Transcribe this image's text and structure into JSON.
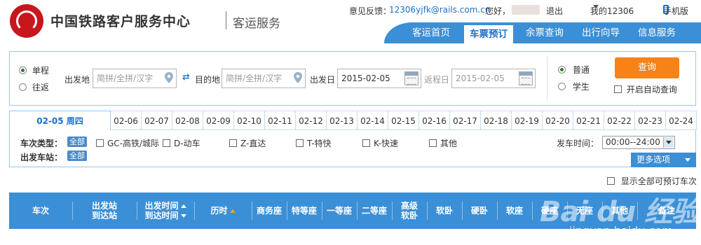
{
  "header": {
    "site_title": "中国铁路客户服务中心",
    "site_subtitle": "客运服务",
    "feedback_label": "意见反馈：",
    "feedback_email": "12306yjfk@rails.com.cn",
    "greeting": "您好，",
    "logout": "退出",
    "my_account": "我的12306",
    "mobile": "手机版"
  },
  "nav": {
    "items": [
      {
        "label": "客运首页"
      },
      {
        "label": "车票预订",
        "active": true
      },
      {
        "label": "余票查询"
      },
      {
        "label": "出行向导"
      },
      {
        "label": "信息服务"
      }
    ]
  },
  "search": {
    "trip_types": [
      {
        "label": "单程",
        "checked": true
      },
      {
        "label": "往返",
        "checked": false
      }
    ],
    "from_label": "出发地",
    "from_placeholder": "简拼/全拼/汉字",
    "to_label": "目的地",
    "to_placeholder": "简拼/全拼/汉字",
    "depart_label": "出发日",
    "depart_value": "2015-02-05",
    "return_label": "返程日",
    "return_value": "2015-02-05",
    "ticket_types": [
      {
        "label": "普通",
        "checked": true
      },
      {
        "label": "学生",
        "checked": false
      }
    ],
    "query_button": "查询",
    "auto_query_label": "开启自动查询"
  },
  "date_tabs": [
    {
      "label": "02-05 周四",
      "active": true
    },
    {
      "label": "02-06"
    },
    {
      "label": "02-07"
    },
    {
      "label": "02-08"
    },
    {
      "label": "02-09"
    },
    {
      "label": "02-10"
    },
    {
      "label": "02-11"
    },
    {
      "label": "02-12"
    },
    {
      "label": "02-13"
    },
    {
      "label": "02-14"
    },
    {
      "label": "02-15"
    },
    {
      "label": "02-16"
    },
    {
      "label": "02-17"
    },
    {
      "label": "02-18"
    },
    {
      "label": "02-19"
    },
    {
      "label": "02-20"
    },
    {
      "label": "02-21"
    },
    {
      "label": "02-22"
    },
    {
      "label": "02-23"
    },
    {
      "label": "02-24"
    }
  ],
  "filters": {
    "train_type_label": "车次类型：",
    "all_label": "全部",
    "train_types": [
      {
        "label": "GC-高铁/城际"
      },
      {
        "label": "D-动车"
      },
      {
        "label": "Z-直达"
      },
      {
        "label": "T-特快"
      },
      {
        "label": "K-快速"
      },
      {
        "label": "其他"
      }
    ],
    "depart_station_label": "出发车站：",
    "depart_station_all": "全部",
    "depart_time_label": "发车时间：",
    "depart_time_value": "00:00--24:00",
    "more_options": "更多选项"
  },
  "show_all_label": "显示全部可预订车次",
  "results_header": {
    "columns": [
      {
        "line1": "车次"
      },
      {
        "line1": "出发站",
        "line2": "到达站"
      },
      {
        "line1": "出发时间",
        "line2": "到达时间",
        "sortable": true
      },
      {
        "line1": "历时",
        "sortable": true
      },
      {
        "line1": "商务座"
      },
      {
        "line1": "特等座"
      },
      {
        "line1": "一等座"
      },
      {
        "line1": "二等座"
      },
      {
        "line1": "高级",
        "line2": "软卧"
      },
      {
        "line1": "软卧"
      },
      {
        "line1": "硬卧"
      },
      {
        "line1": "软座"
      },
      {
        "line1": "硬座"
      },
      {
        "line1": "无座"
      },
      {
        "line1": "其他"
      },
      {
        "line1": "备注"
      }
    ]
  },
  "watermark": {
    "logo": "Bai du 经验",
    "url": "jingyan.baidu.com"
  },
  "colors": {
    "brand_red": "#c8161d",
    "nav_blue": "#3b8fd6",
    "query_orange": "#f78217",
    "link_blue": "#1a6fc9"
  }
}
